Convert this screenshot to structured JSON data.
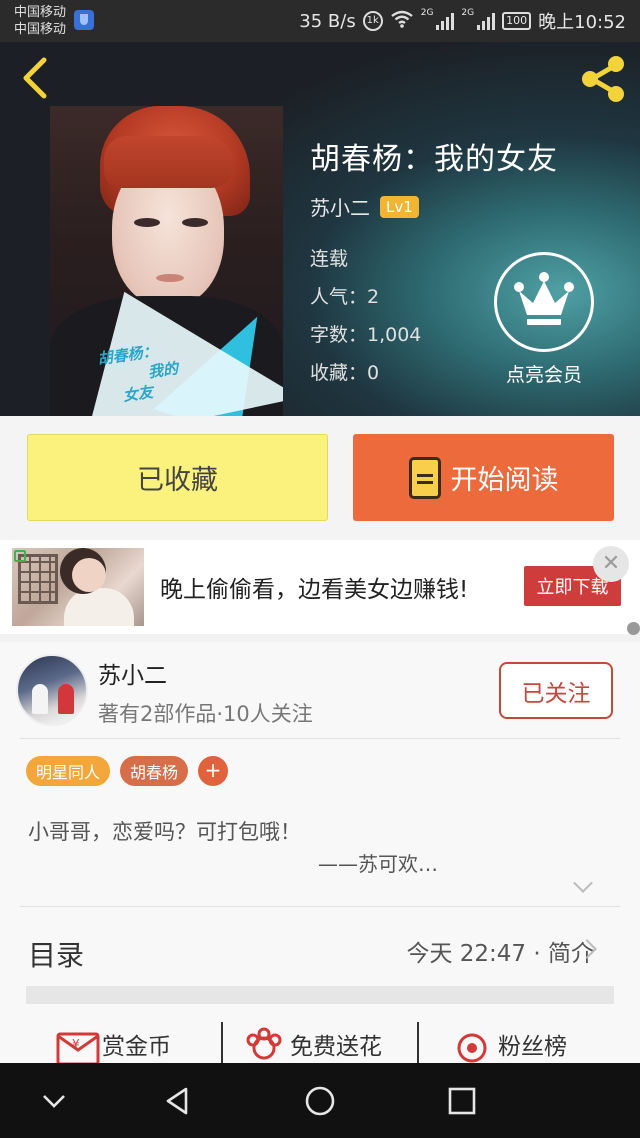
{
  "status_bar": {
    "carrier_1": "中国移动",
    "carrier_2": "中国移动",
    "speed": "35 B/s",
    "hd_label": "1k",
    "net_label_1": "2G",
    "net_label_2": "2G",
    "battery": "100",
    "time": "晚上10:52"
  },
  "header": {
    "back_icon": "chevron-left-icon",
    "share_icon": "share-icon",
    "cover_text": [
      "胡春杨：",
      "我的",
      "女友"
    ],
    "title": "胡春杨：我的女友",
    "author": "苏小二",
    "level": "Lv1",
    "status": "连载",
    "popularity": "人气：2",
    "word_count": "字数：1,004",
    "favorites": "收藏：0",
    "vip_label": "点亮会员",
    "colors": {
      "accent": "#f2c531",
      "badge": "#f2b533"
    }
  },
  "actions": {
    "favorited_label": "已收藏",
    "read_label": "开始阅读",
    "colors": {
      "favorited_bg": "#fbf27e",
      "read_bg": "#ec6a3b"
    }
  },
  "ad": {
    "text": "晚上偷偷看，边看美女边赚钱!",
    "button": "立即下载",
    "close": "✕"
  },
  "author_card": {
    "name": "苏小二",
    "stats": "著有2部作品·10人关注",
    "follow_label": "已关注",
    "tags": [
      "明星同人",
      "胡春杨"
    ],
    "tag_add": "+",
    "intro": "小哥哥，恋爱吗？可打包哦！",
    "signature": "——苏可欢…",
    "toc_label": "目录",
    "toc_right": "今天 22:47 · 简介"
  },
  "bottom_actions": [
    {
      "icon": "coin-envelope-icon",
      "label": "赏金币"
    },
    {
      "icon": "flower-icon",
      "label": "免费送花"
    },
    {
      "icon": "fan-rank-icon",
      "label": "粉丝榜"
    }
  ],
  "nav": {
    "icons": [
      "chevron-down-icon",
      "back-triangle-icon",
      "home-circle-icon",
      "recents-square-icon"
    ]
  }
}
